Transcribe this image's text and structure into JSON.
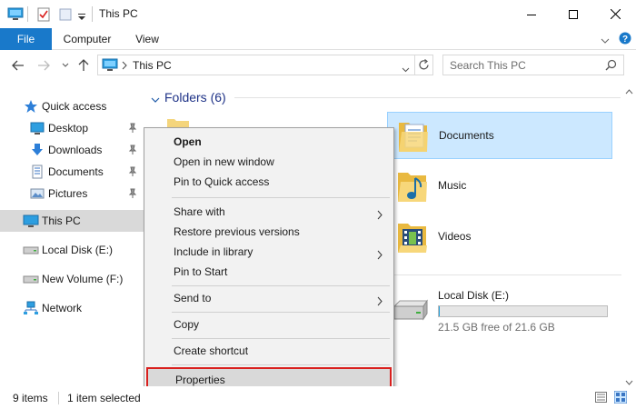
{
  "window": {
    "title": "This PC",
    "quick_access_toolbar": [
      "computer-icon",
      "properties-icon",
      "new-folder-icon",
      "customize-arrow-icon"
    ],
    "controls": [
      "minimize",
      "maximize",
      "close"
    ]
  },
  "ribbon": {
    "tabs": [
      "File",
      "Computer",
      "View"
    ],
    "accent": "#1979ca"
  },
  "address": {
    "path": [
      "This PC"
    ],
    "search_placeholder": "Search This PC"
  },
  "nav_pane": {
    "quick_access": "Quick access",
    "quick_items": [
      "Desktop",
      "Downloads",
      "Documents",
      "Pictures"
    ],
    "this_pc": "This PC",
    "drives": [
      "Local Disk (E:)",
      "New Volume (F:)"
    ],
    "network": "Network"
  },
  "content": {
    "folders_header": "Folders (6)",
    "folders": [
      "Documents",
      "Music",
      "Videos"
    ],
    "drive": {
      "name": "Local Disk (E:)",
      "free_text": "21.5 GB free of 21.6 GB",
      "used_fraction": 0.005
    }
  },
  "context_menu": {
    "items": [
      {
        "label": "Open",
        "bold": true
      },
      {
        "label": "Open in new window"
      },
      {
        "label": "Pin to Quick access"
      },
      {
        "label": "Share with",
        "submenu": true
      },
      {
        "label": "Restore previous versions"
      },
      {
        "label": "Include in library",
        "submenu": true
      },
      {
        "label": "Pin to Start"
      },
      {
        "label": "Send to",
        "submenu": true
      },
      {
        "label": "Copy"
      },
      {
        "label": "Create shortcut"
      },
      {
        "label": "Properties",
        "highlighted": true
      }
    ],
    "highlight_color": "#d9d9d9",
    "outline_color": "#d9201e"
  },
  "status": {
    "item_count": "9 items",
    "selection": "1 item selected"
  }
}
